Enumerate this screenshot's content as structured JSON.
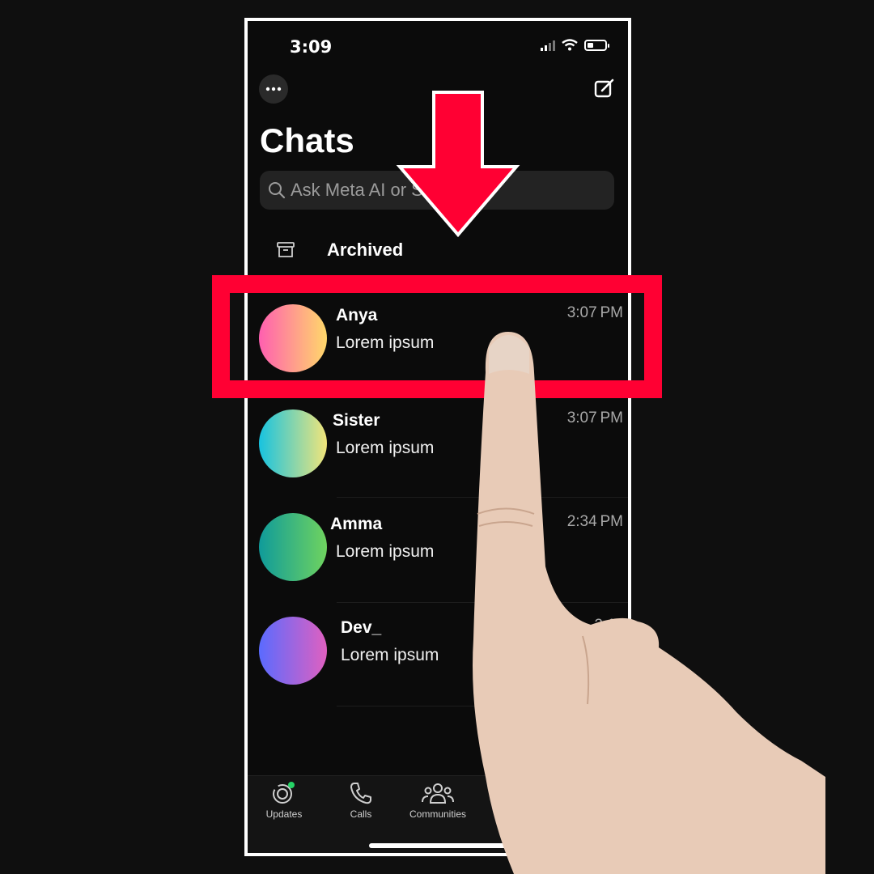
{
  "status": {
    "time": "3:09"
  },
  "header": {
    "title": "Chats",
    "menu_icon": "ellipsis-icon",
    "compose_icon": "compose-icon"
  },
  "search": {
    "placeholder": "Ask Meta AI or S"
  },
  "archived": {
    "label": "Archived"
  },
  "chats": [
    {
      "name": "Anya",
      "message": "Lorem ipsum",
      "time": "3:07 PM",
      "avatar_colors": [
        "#ff5fb0",
        "#ffd86a"
      ]
    },
    {
      "name": "Sister",
      "message": "Lorem ipsum",
      "time": "3:07 PM",
      "avatar_colors": [
        "#17c3e0",
        "#f2e57a"
      ]
    },
    {
      "name": "Amma",
      "message": "Lorem ipsum",
      "time": "2:34 PM",
      "avatar_colors": [
        "#0f9b9a",
        "#6fd35f"
      ]
    },
    {
      "name": "Dev_",
      "message": "Lorem ipsum",
      "time": "2:11",
      "avatar_colors": [
        "#5a6bff",
        "#e060c0"
      ]
    }
  ],
  "tabs": [
    {
      "label": "Updates",
      "icon": "updates-icon"
    },
    {
      "label": "Calls",
      "icon": "phone-icon"
    },
    {
      "label": "Communities",
      "icon": "communities-icon"
    }
  ],
  "colors": {
    "highlight": "#ff0033",
    "background": "#0b0b0b"
  }
}
